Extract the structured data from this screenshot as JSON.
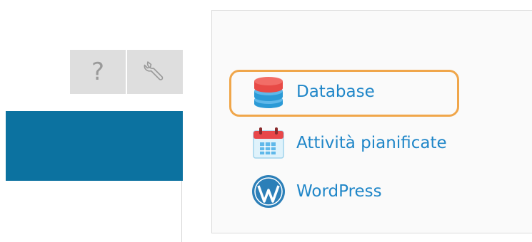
{
  "toolbar": {
    "help_icon": "question-mark-icon",
    "tools_icon": "wrench-icon",
    "help_glyph": "?"
  },
  "panel": {
    "items": [
      {
        "label": "Database",
        "icon": "database-icon",
        "highlighted": true
      },
      {
        "label": "Attività pianificate",
        "icon": "calendar-icon"
      },
      {
        "label": "WordPress",
        "icon": "wordpress-icon"
      }
    ]
  },
  "colors": {
    "accent_bar": "#0c72a0",
    "link": "#1f86c8",
    "highlight": "#f0a64a",
    "toolbar_bg": "#dedede"
  }
}
